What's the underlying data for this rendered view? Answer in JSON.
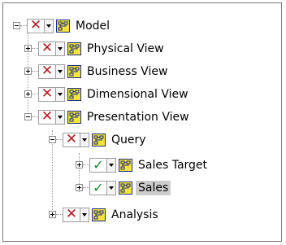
{
  "tree": {
    "nodes": [
      {
        "key": "model",
        "label": "Model",
        "status": "x",
        "expander": "minus",
        "selected": false
      },
      {
        "key": "physical-view",
        "label": "Physical View",
        "status": "x",
        "expander": "plus",
        "selected": false
      },
      {
        "key": "business-view",
        "label": "Business View",
        "status": "x",
        "expander": "plus",
        "selected": false
      },
      {
        "key": "dimensional-view",
        "label": "Dimensional View",
        "status": "x",
        "expander": "plus",
        "selected": false
      },
      {
        "key": "presentation-view",
        "label": "Presentation View",
        "status": "x",
        "expander": "minus",
        "selected": false
      },
      {
        "key": "query",
        "label": "Query",
        "status": "x",
        "expander": "minus",
        "selected": false
      },
      {
        "key": "sales-target",
        "label": "Sales Target",
        "status": "check",
        "expander": "plus",
        "selected": false
      },
      {
        "key": "sales",
        "label": "Sales",
        "status": "check",
        "expander": "plus",
        "selected": true
      },
      {
        "key": "analysis",
        "label": "Analysis",
        "status": "x",
        "expander": "plus",
        "selected": false
      }
    ],
    "status_glyphs": {
      "x": "✕",
      "check": "✓"
    },
    "colors": {
      "x_status": "#b01e23",
      "check_status": "#1a8a2a",
      "icon_fill": "#f2e533",
      "icon_border": "#1c2a8c",
      "selection": "#cccccc"
    },
    "icon": "model-node-icon"
  }
}
